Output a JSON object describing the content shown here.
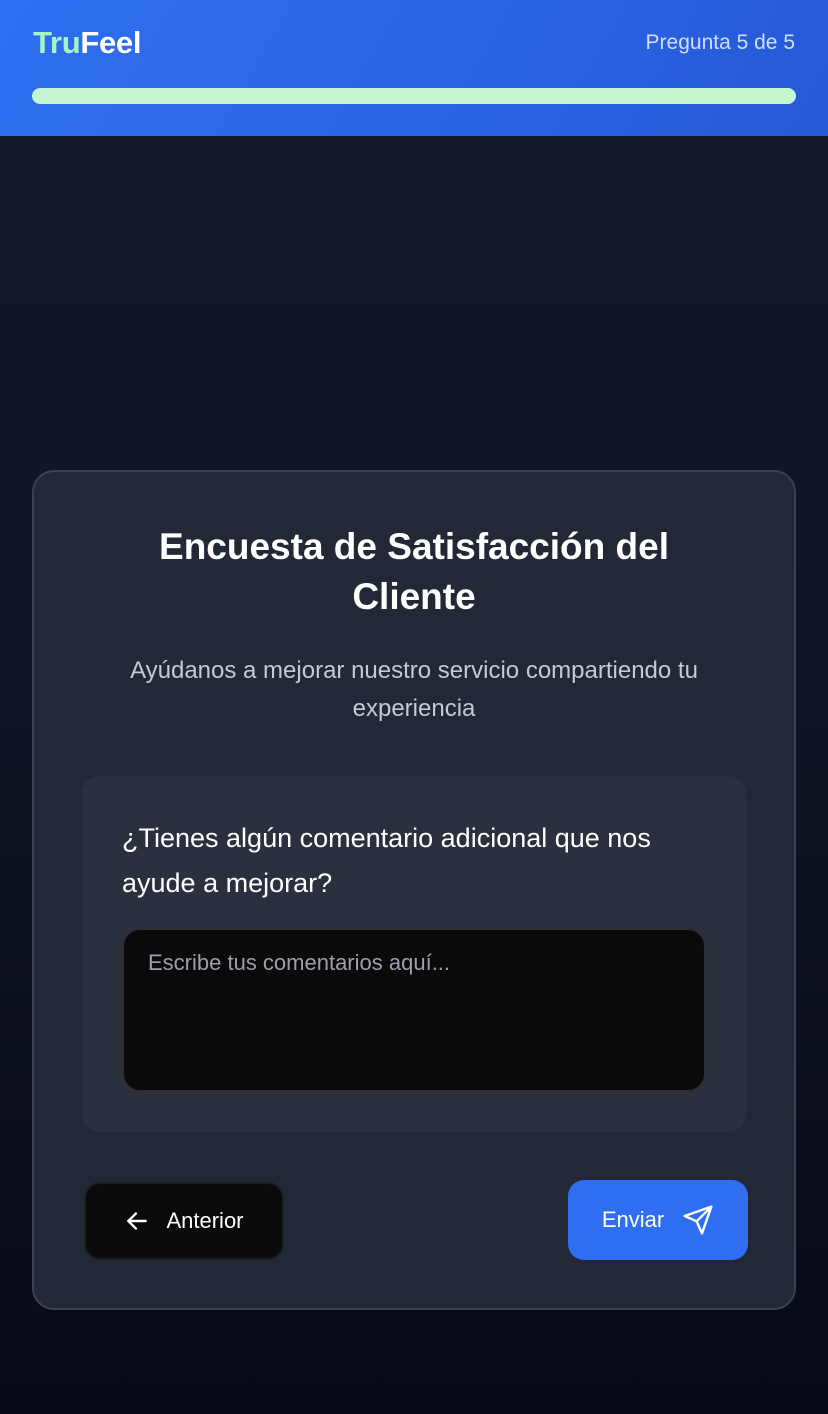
{
  "header": {
    "brand_part1": "Tru",
    "brand_part2": "Feel",
    "step_text": "Pregunta 5 de 5",
    "progress": 1.0
  },
  "card": {
    "title": "Encuesta de Satisfacción del Cliente",
    "subtitle": "Ayúdanos a mejorar nuestro servicio compartiendo tu experiencia",
    "question": "¿Tienes algún comentario adicional que nos ayude a mejorar?",
    "comment": {
      "value": "",
      "placeholder": "Escribe tus comentarios aquí..."
    },
    "prev_button": {
      "label": "Anterior",
      "icon": "arrow-left-icon"
    },
    "send_button": {
      "label": "Enviar",
      "icon": "send-icon"
    }
  },
  "colors": {
    "accent": "#2f6ef0",
    "brand_highlight": "#a7f3c5",
    "progress_fill": "#c6f6cf",
    "card_bg": "#222835",
    "page_bg": "#111827"
  }
}
